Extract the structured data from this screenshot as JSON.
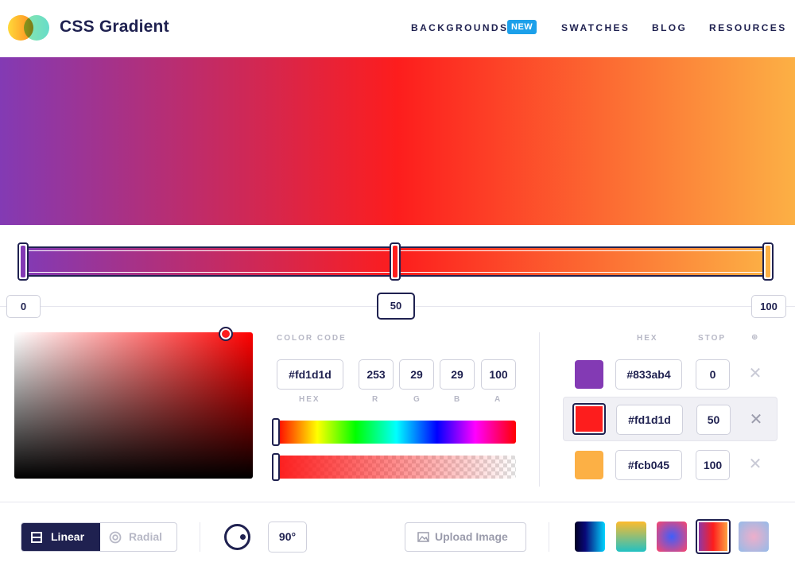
{
  "header": {
    "brand": "CSS Gradient",
    "nav": [
      "BACKGROUNDS",
      "SWATCHES",
      "BLOG",
      "RESOURCES"
    ],
    "badge": "NEW"
  },
  "gradient": {
    "colors": [
      "#833ab4",
      "#fd1d1d",
      "#fcb045"
    ],
    "stops": [
      "0",
      "50",
      "100"
    ]
  },
  "picker": {
    "title": "COLOR CODE",
    "hex": "#fd1d1d",
    "r": "253",
    "g": "29",
    "b": "29",
    "a": "100",
    "labels": {
      "hex": "HEX",
      "r": "R",
      "g": "G",
      "b": "B",
      "a": "A"
    }
  },
  "stops_panel": {
    "header_hex": "HEX",
    "header_stop": "STOP",
    "header_add": "⊕",
    "rows": [
      {
        "color": "#833ab4",
        "hex": "#833ab4",
        "stop": "0",
        "active": false
      },
      {
        "color": "#fd1d1d",
        "hex": "#fd1d1d",
        "stop": "50",
        "active": true
      },
      {
        "color": "#fcb045",
        "hex": "#fcb045",
        "stop": "100",
        "active": false
      }
    ],
    "remove_label": "✕"
  },
  "bottom": {
    "linear": "Linear",
    "radial": "Radial",
    "angle": "90°",
    "upload": "Upload Image"
  },
  "presets": [
    "linear-gradient(90deg,#020024,#090979 35%,#00d4ff)",
    "linear-gradient(0deg,#22c1c3,#fdbb2d)",
    "radial-gradient(circle,#3f5efb,#fc466b)",
    "linear-gradient(90deg,#833ab4,#fd1d1d 50%,#fcb045)",
    "radial-gradient(circle,#eeaeca,#94bbe9)"
  ]
}
